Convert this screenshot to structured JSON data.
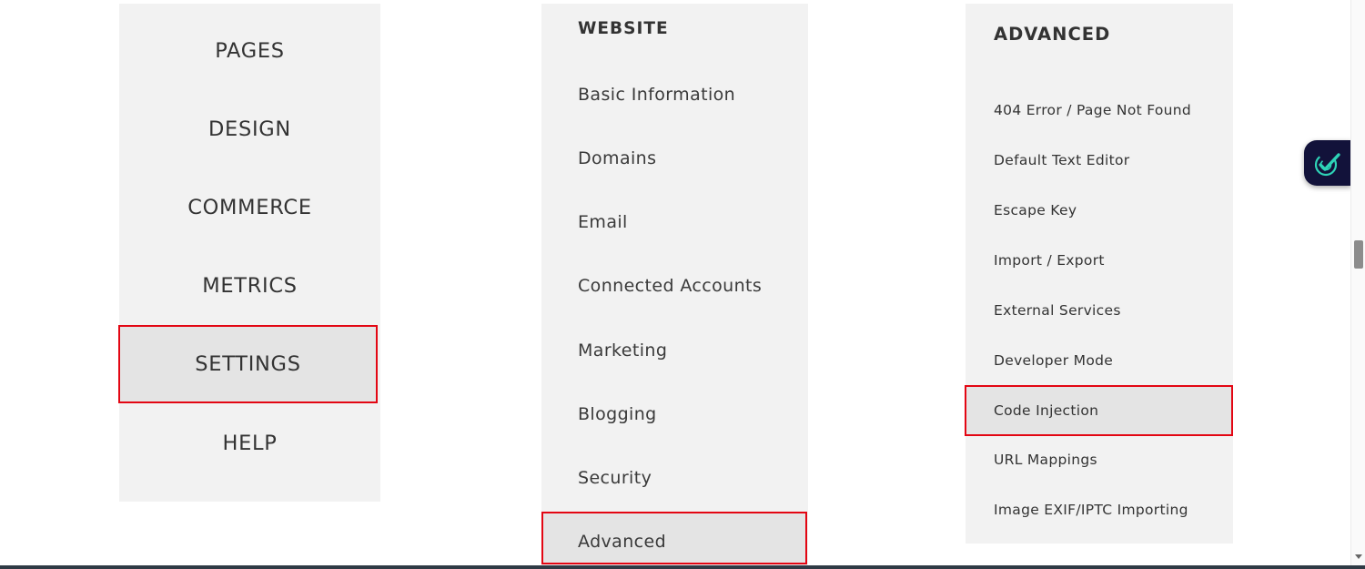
{
  "main_nav": {
    "items": [
      {
        "label": "PAGES"
      },
      {
        "label": "DESIGN"
      },
      {
        "label": "COMMERCE"
      },
      {
        "label": "METRICS"
      },
      {
        "label": "SETTINGS"
      },
      {
        "label": "HELP"
      }
    ],
    "selected": "SETTINGS"
  },
  "settings_nav": {
    "header": "WEBSITE",
    "items": [
      {
        "label": "Basic Information"
      },
      {
        "label": "Domains"
      },
      {
        "label": "Email"
      },
      {
        "label": "Connected Accounts"
      },
      {
        "label": "Marketing"
      },
      {
        "label": "Blogging"
      },
      {
        "label": "Security"
      },
      {
        "label": "Advanced"
      }
    ],
    "selected": "Advanced"
  },
  "advanced_panel": {
    "header": "ADVANCED",
    "items": [
      {
        "label": "404 Error / Page Not Found"
      },
      {
        "label": "Default Text Editor"
      },
      {
        "label": "Escape Key"
      },
      {
        "label": "Import / Export"
      },
      {
        "label": "External Services"
      },
      {
        "label": "Developer Mode"
      },
      {
        "label": "Code Injection"
      },
      {
        "label": "URL Mappings"
      },
      {
        "label": "Image EXIF/IPTC Importing"
      }
    ],
    "selected": "Code Injection"
  },
  "floating_widget": {
    "icon": "check-badge-icon"
  },
  "colors": {
    "panel_bg": "#f2f2f2",
    "selected_bg": "#e4e4e4",
    "highlight_border": "#e30613",
    "widget_bg": "#12123a",
    "widget_accent": "#2ed3b7"
  }
}
